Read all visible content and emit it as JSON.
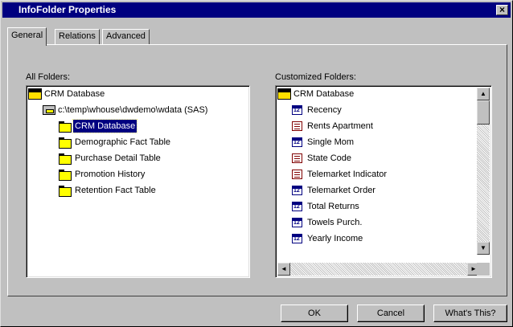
{
  "window": {
    "title": "InfoFolder Properties",
    "close_glyph": "×"
  },
  "tabs": [
    {
      "label": "General",
      "active": true
    },
    {
      "label": "Relations",
      "active": false
    },
    {
      "label": "Advanced",
      "active": false
    }
  ],
  "all_folders": {
    "label": "All Folders:",
    "root": "CRM Database",
    "library": "c:\\temp\\whouse\\dwdemo\\wdata (SAS)",
    "items": [
      {
        "label": "CRM Database",
        "selected": true
      },
      {
        "label": "Demographic Fact Table",
        "selected": false
      },
      {
        "label": "Purchase Detail Table",
        "selected": false
      },
      {
        "label": "Promotion History",
        "selected": false
      },
      {
        "label": "Retention Fact Table",
        "selected": false
      }
    ]
  },
  "customized_folders": {
    "label": "Customized Folders:",
    "root": "CRM Database",
    "items": [
      {
        "label": "Recency",
        "icon": "numeric-column-icon"
      },
      {
        "label": "Rents Apartment",
        "icon": "character-column-icon"
      },
      {
        "label": "Single Mom",
        "icon": "numeric-column-icon"
      },
      {
        "label": "State Code",
        "icon": "character-column-icon"
      },
      {
        "label": "Telemarket Indicator",
        "icon": "character-column-icon"
      },
      {
        "label": "Telemarket Order",
        "icon": "numeric-column-icon"
      },
      {
        "label": "Total Returns",
        "icon": "numeric-column-icon"
      },
      {
        "label": "Towels Purch.",
        "icon": "numeric-column-icon"
      },
      {
        "label": "Yearly Income",
        "icon": "numeric-column-icon"
      }
    ]
  },
  "buttons": {
    "ok": "OK",
    "cancel": "Cancel",
    "whats_this": "What's This?"
  },
  "scroll_glyphs": {
    "up": "▲",
    "down": "▼",
    "left": "◄",
    "right": "►"
  },
  "colors": {
    "titlebar": "#000080",
    "dialog": "#c0c0c0",
    "selection": "#000080"
  }
}
